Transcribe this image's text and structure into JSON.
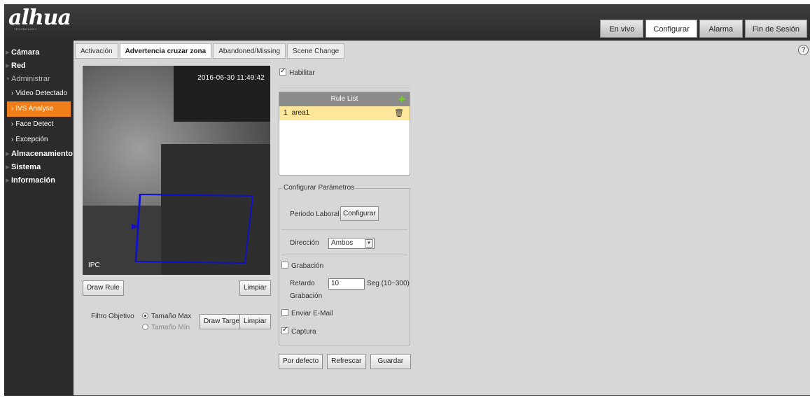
{
  "header": {
    "logo": "alhua",
    "logo_sub": "TECHNOLOGY",
    "tabs": [
      "En vivo",
      "Configurar",
      "Alarma",
      "Fin de Sesión"
    ],
    "active_tab": "Configurar"
  },
  "sidebar": {
    "items": [
      {
        "label": "Cámara"
      },
      {
        "label": "Red"
      },
      {
        "label": "Administrar"
      },
      {
        "label": "Video Detectado"
      },
      {
        "label": "IVS Analyse"
      },
      {
        "label": "Face Detect"
      },
      {
        "label": "Excepción"
      },
      {
        "label": "Almacenamiento"
      },
      {
        "label": "Sistema"
      },
      {
        "label": "Información"
      }
    ]
  },
  "tabs": [
    "Activación",
    "Advertencia cruzar zona",
    "Abandoned/Missing",
    "Scene Change"
  ],
  "help_icon": "?",
  "video": {
    "timestamp": "2016-06-30 11:49:42",
    "label": "IPC"
  },
  "buttons": {
    "draw_rule": "Draw Rule",
    "limpiar": "Limpiar",
    "draw_target": "Draw Target",
    "por_defecto": "Por defecto",
    "refrescar": "Refrescar",
    "guardar": "Guardar",
    "configurar": "Configurar"
  },
  "filtro": {
    "label": "Filtro Objetivo",
    "option_max": "Tamaño Max",
    "option_min": "Tamaño Mín"
  },
  "habilitar": "Habilitar",
  "rule_list": {
    "title": "Rule List",
    "rows": [
      {
        "num": "1",
        "name": "area1"
      }
    ]
  },
  "params": {
    "legend": "Configurar Parámetros",
    "periodo_label": "Periodo Laboral",
    "direccion_label": "Dirección",
    "direccion_value": "Ambos",
    "grabacion_label": "Grabación",
    "retardo_label_1": "Retardo",
    "retardo_label_2": "Grabación",
    "retardo_value": "10",
    "retardo_unit": "Seg (10~300)",
    "email_label": "Enviar E-Mail",
    "captura_label": "Captura"
  },
  "colors": {
    "active_sidebar": "#f07f1a",
    "rule_row_highlight": "#fde79a",
    "rule_line": "#1010c8"
  }
}
